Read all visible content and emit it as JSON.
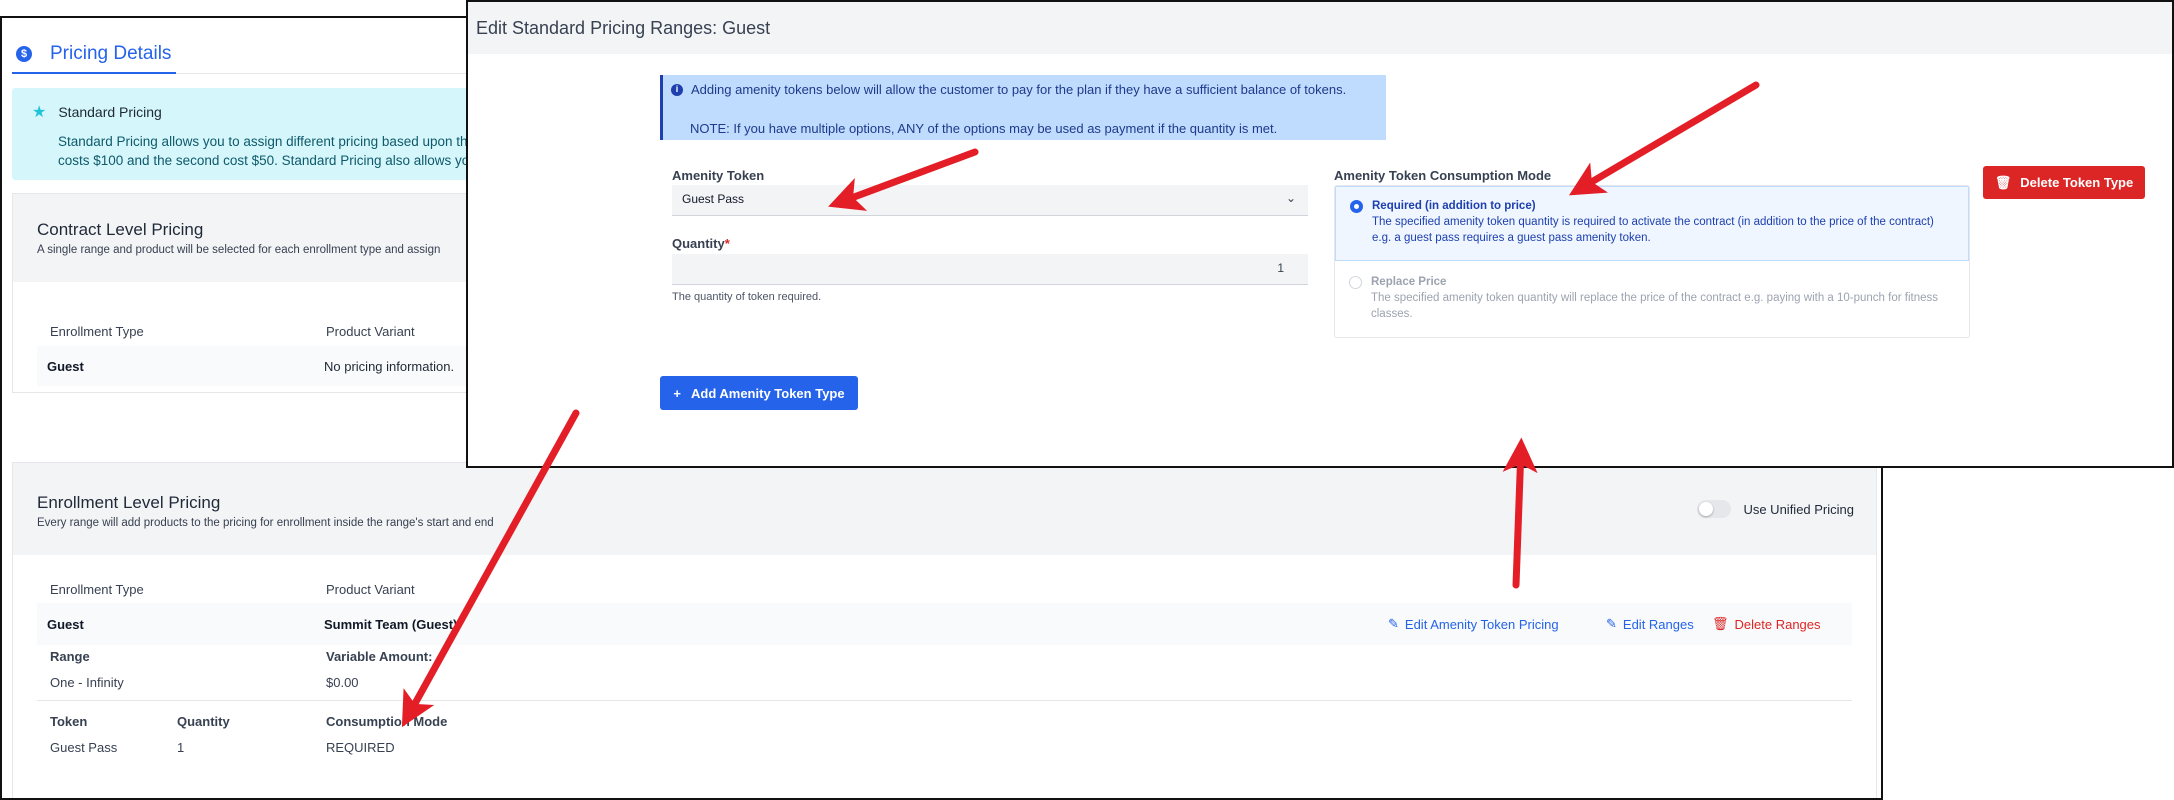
{
  "pricing_details": {
    "tab_label": "Pricing Details",
    "standard_pricing": {
      "title": "Standard Pricing",
      "text_line1": "Standard Pricing allows you to assign different pricing based upon the",
      "text_line2": "costs $100 and the second cost $50. Standard Pricing also allows you"
    },
    "contract_level": {
      "title": "Contract Level Pricing",
      "subtitle": "A single range and product will be selected for each enrollment type and assign",
      "col_enrollment_type": "Enrollment Type",
      "col_product_variant": "Product Variant",
      "row_type": "Guest",
      "row_variant": "No pricing information."
    },
    "enrollment_level": {
      "title": "Enrollment Level Pricing",
      "subtitle": "Every range will add products to the pricing for enrollment inside the range's start and end",
      "toggle_label": "Use Unified Pricing",
      "col_enrollment_type": "Enrollment Type",
      "col_product_variant": "Product Variant",
      "row_type": "Guest",
      "row_variant": "Summit Team (Guest)",
      "edit_amenity_label": "Edit Amenity Token Pricing",
      "edit_ranges_label": "Edit Ranges",
      "delete_ranges_label": "Delete Ranges",
      "range_label": "Range",
      "range_value": "One - Infinity",
      "variable_amount_label": "Variable Amount:",
      "variable_amount_value": "$0.00",
      "token_col": "Token",
      "quantity_col": "Quantity",
      "consumption_col": "Consumption Mode",
      "token_value": "Guest Pass",
      "quantity_value": "1",
      "consumption_value": "REQUIRED"
    }
  },
  "modal": {
    "title": "Edit Standard Pricing Ranges: Guest",
    "info_line1": "Adding amenity tokens below will allow the customer to pay for the plan if they have a sufficient balance of tokens.",
    "info_line2": "NOTE: If you have multiple options, ANY of the options may be used as payment if the quantity is met.",
    "amenity_token_label": "Amenity Token",
    "amenity_token_value": "Guest Pass",
    "quantity_label": "Quantity",
    "quantity_required_mark": "*",
    "quantity_value": "1",
    "quantity_help": "The quantity of token required.",
    "consumption_mode_label": "Amenity Token Consumption Mode",
    "option_required_title": "Required (in addition to price)",
    "option_required_desc": "The specified amenity token quantity is required to activate the contract (in addition to the price of the contract) e.g. a guest pass requires a guest pass amenity token.",
    "option_replace_title": "Replace Price",
    "option_replace_desc": "The specified amenity token quantity will replace the price of the contract e.g. paying with a 10-punch for fitness classes.",
    "delete_token_type_label": "Delete Token Type",
    "add_token_type_label": "Add Amenity Token Type"
  },
  "colors": {
    "primary_blue": "#2563eb",
    "danger_red": "#dc2626",
    "annotation_red": "#e41e26",
    "info_cyan": "#d5f6fb"
  }
}
